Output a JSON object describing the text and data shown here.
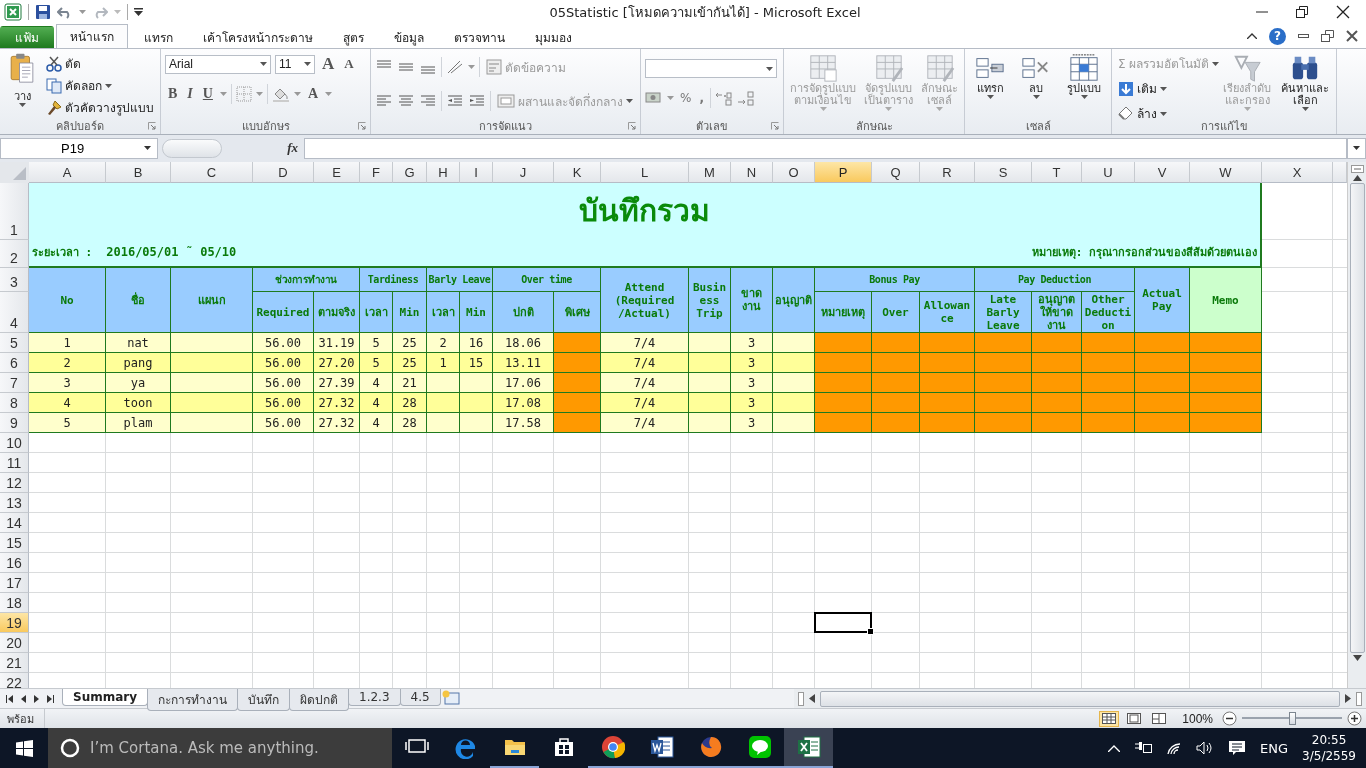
{
  "window": {
    "title": "05Statistic  [โหมดความเข้ากันได้] - Microsoft Excel",
    "help_label": "?"
  },
  "ribbon_tabs": [
    {
      "label": "แฟ้ม",
      "kind": "file",
      "selected": false
    },
    {
      "label": "หน้าแรก",
      "kind": "tab",
      "selected": true
    },
    {
      "label": "แทรก",
      "kind": "tab",
      "selected": false
    },
    {
      "label": "เค้าโครงหน้ากระดาษ",
      "kind": "tab",
      "selected": false
    },
    {
      "label": "สูตร",
      "kind": "tab",
      "selected": false
    },
    {
      "label": "ข้อมูล",
      "kind": "tab",
      "selected": false
    },
    {
      "label": "ตรวจทาน",
      "kind": "tab",
      "selected": false
    },
    {
      "label": "มุมมอง",
      "kind": "tab",
      "selected": false
    }
  ],
  "ribbon_groups": [
    {
      "kind": "clipboard",
      "label": "คลิปบอร์ด",
      "paste": "วาง",
      "cut": "ตัด",
      "copy": "คัดลอก",
      "format_painter": "ตัวคัดวางรูปแบบ"
    },
    {
      "kind": "font",
      "label": "แบบอักษร",
      "font": "Arial",
      "size": "11",
      "grow": "A",
      "shrink": "A",
      "bold": "B",
      "italic": "I",
      "underline": "U",
      "font_color": "A"
    },
    {
      "kind": "alignment",
      "label": "การจัดแนว",
      "wrap": {
        "label": "ตัดข้อความ",
        "disabled": true
      },
      "merge": {
        "label": "ผสานและจัดกึ่งกลาง",
        "disabled": true
      }
    },
    {
      "kind": "number",
      "label": "ตัวเลข",
      "percent": "%",
      "comma": ","
    },
    {
      "kind": "big_buttons",
      "label": "ลักษณะ",
      "buttons": [
        {
          "lines": [
            "การจัดรูปแบบ",
            "ตามเงื่อนไข"
          ],
          "disabled": true
        },
        {
          "lines": [
            "จัดรูปแบบ",
            "เป็นตาราง"
          ],
          "disabled": true
        },
        {
          "lines": [
            "ลักษณะ",
            "เซลล์"
          ],
          "disabled": true
        }
      ]
    },
    {
      "kind": "big_buttons",
      "label": "เซลล์",
      "buttons": [
        {
          "lines": [
            "แทรก"
          ],
          "disabled": false
        },
        {
          "lines": [
            "ลบ"
          ],
          "disabled": false
        },
        {
          "lines": [
            "รูปแบบ"
          ],
          "disabled": false
        }
      ]
    },
    {
      "kind": "editing",
      "label": "การแก้ไข",
      "small": [
        {
          "symbol": "Σ",
          "label": "ผลรวมอัตโนมัติ",
          "disabled": true
        },
        {
          "label": "เติม",
          "disabled": false
        },
        {
          "label": "ล้าง",
          "disabled": false
        }
      ],
      "buttons": [
        {
          "lines": [
            "เรียงลำดับ",
            "และกรอง"
          ],
          "disabled": true
        },
        {
          "lines": [
            "ค้นหาและ",
            "เลือก"
          ],
          "disabled": false
        }
      ]
    }
  ],
  "formula_bar": {
    "name_box": "P19",
    "fx_label": "fx"
  },
  "sheet": {
    "columns": [
      {
        "label": "A",
        "selected": false
      },
      {
        "label": "B",
        "selected": false
      },
      {
        "label": "C",
        "selected": false
      },
      {
        "label": "D",
        "selected": false
      },
      {
        "label": "E",
        "selected": false
      },
      {
        "label": "F",
        "selected": false
      },
      {
        "label": "G",
        "selected": false
      },
      {
        "label": "H",
        "selected": false
      },
      {
        "label": "I",
        "selected": false
      },
      {
        "label": "J",
        "selected": false
      },
      {
        "label": "K",
        "selected": false
      },
      {
        "label": "L",
        "selected": false
      },
      {
        "label": "M",
        "selected": false
      },
      {
        "label": "N",
        "selected": false
      },
      {
        "label": "O",
        "selected": false
      },
      {
        "label": "P",
        "selected": true
      },
      {
        "label": "Q",
        "selected": false
      },
      {
        "label": "R",
        "selected": false
      },
      {
        "label": "S",
        "selected": false
      },
      {
        "label": "T",
        "selected": false
      },
      {
        "label": "U",
        "selected": false
      },
      {
        "label": "V",
        "selected": false
      },
      {
        "label": "W",
        "selected": false
      },
      {
        "label": "X",
        "selected": false
      }
    ],
    "rows": [
      {
        "label": "1",
        "selected": false
      },
      {
        "label": "2",
        "selected": false
      },
      {
        "label": "3",
        "selected": false
      },
      {
        "label": "4",
        "selected": false
      },
      {
        "label": "5",
        "selected": false
      },
      {
        "label": "6",
        "selected": false
      },
      {
        "label": "7",
        "selected": false
      },
      {
        "label": "8",
        "selected": false
      },
      {
        "label": "9",
        "selected": false
      },
      {
        "label": "10",
        "selected": false
      },
      {
        "label": "11",
        "selected": false
      },
      {
        "label": "12",
        "selected": false
      },
      {
        "label": "13",
        "selected": false
      },
      {
        "label": "14",
        "selected": false
      },
      {
        "label": "15",
        "selected": false
      },
      {
        "label": "16",
        "selected": false
      },
      {
        "label": "17",
        "selected": false
      },
      {
        "label": "18",
        "selected": false
      },
      {
        "label": "19",
        "selected": true
      },
      {
        "label": "20",
        "selected": false
      },
      {
        "label": "21",
        "selected": false
      },
      {
        "label": "22",
        "selected": false
      }
    ],
    "title": "บันทึกรวม",
    "period_label": "ระยะเวลา :",
    "period": "2016/05/01 ˜ 05/10",
    "note": "หมายเหตุ:  กรุณากรอกส่วนของสีส้มด้วยตนเอง",
    "header": [
      {
        "label": "No"
      },
      {
        "label": "ชื่อ"
      },
      {
        "label": "แผนก"
      },
      {
        "label": "ช่วงการทำงาน",
        "children": [
          {
            "label": "Required"
          },
          {
            "label": "ตามจริง"
          }
        ]
      },
      {
        "label": "Tardiness",
        "children": [
          {
            "label": "เวลา"
          },
          {
            "label": "Min"
          }
        ]
      },
      {
        "label": "Barly Leave",
        "children": [
          {
            "label": "เวลา"
          },
          {
            "label": "Min"
          }
        ]
      },
      {
        "label": "Over time",
        "children": [
          {
            "label": "ปกติ"
          },
          {
            "label": "พิเศษ"
          }
        ]
      },
      {
        "label": "Attend (Required /Actual)"
      },
      {
        "label": "Business Trip"
      },
      {
        "label": "ขาดงาน"
      },
      {
        "label": "อนุญาติ"
      },
      {
        "label": "Bonus Pay",
        "children": [
          {
            "label": "หมายเหตุ"
          },
          {
            "label": "Over"
          },
          {
            "label": "Allowance"
          }
        ]
      },
      {
        "label": "Pay Deduction",
        "children": [
          {
            "label": "Late Barly Leave"
          },
          {
            "label": "อนุญาตให้ขาดงาน"
          },
          {
            "label": "Other Deduction"
          }
        ]
      },
      {
        "label": "Actual Pay"
      },
      {
        "label": "Memo"
      }
    ],
    "records": [
      {
        "no": "1",
        "name": "nat",
        "required": "56.00",
        "actual": "31.19",
        "late_times": "5",
        "late_min": "25",
        "early_times": "2",
        "early_min": "16",
        "ot_normal": "18.06",
        "attend": "7/4",
        "absent": "3"
      },
      {
        "no": "2",
        "name": "pang",
        "required": "56.00",
        "actual": "27.20",
        "late_times": "5",
        "late_min": "25",
        "early_times": "1",
        "early_min": "15",
        "ot_normal": "13.11",
        "attend": "7/4",
        "absent": "3"
      },
      {
        "no": "3",
        "name": "ya",
        "required": "56.00",
        "actual": "27.39",
        "late_times": "4",
        "late_min": "21",
        "ot_normal": "17.06",
        "attend": "7/4",
        "absent": "3"
      },
      {
        "no": "4",
        "name": "toon",
        "required": "56.00",
        "actual": "27.32",
        "late_times": "4",
        "late_min": "28",
        "ot_normal": "17.08",
        "attend": "7/4",
        "absent": "3"
      },
      {
        "no": "5",
        "name": "plam",
        "required": "56.00",
        "actual": "27.32",
        "late_times": "4",
        "late_min": "28",
        "ot_normal": "17.58",
        "attend": "7/4",
        "absent": "3"
      }
    ]
  },
  "sheet_tabs": [
    {
      "label": "Summary",
      "selected": true
    },
    {
      "label": "กะการทำงาน",
      "selected": false
    },
    {
      "label": "บันทึก",
      "selected": false
    },
    {
      "label": "ผิดปกติ",
      "selected": false
    },
    {
      "label": "1.2.3",
      "selected": false
    },
    {
      "label": "4.5",
      "selected": false
    }
  ],
  "status_bar": {
    "status": "พร้อม",
    "zoom": "100%",
    "zoom_slider": {
      "level": 0.5
    }
  },
  "taskbar": {
    "search": {
      "placeholder": "I’m Cortana. Ask me anything."
    },
    "apps": [
      {
        "running": false,
        "selected": false
      },
      {
        "running": false,
        "selected": false
      },
      {
        "running": true,
        "selected": false
      },
      {
        "running": false,
        "selected": false
      },
      {
        "running": true,
        "selected": false
      },
      {
        "running": true,
        "selected": false
      },
      {
        "running": true,
        "selected": false
      },
      {
        "running": true,
        "selected": false
      },
      {
        "running": true,
        "selected": true
      }
    ],
    "language": "ENG",
    "time": "20:55",
    "date": "3/5/2559"
  }
}
